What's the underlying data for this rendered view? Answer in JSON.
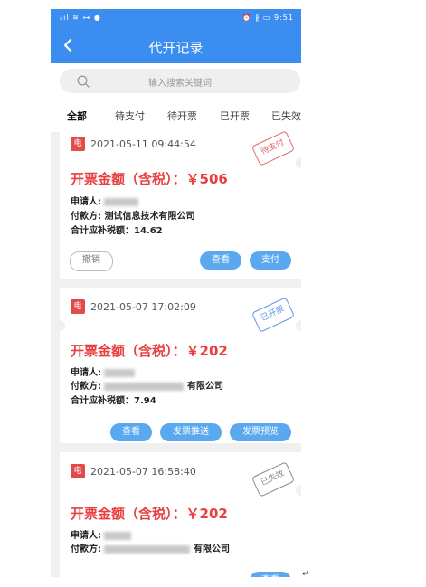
{
  "status_bar": {
    "left": "ₐıl ≋ ⊶ ●",
    "right": "⏰ ∦ ▭ 9:51"
  },
  "nav": {
    "title": "代开记录"
  },
  "search": {
    "placeholder": "输入搜索关键词"
  },
  "tabs": [
    "全部",
    "待支付",
    "待开票",
    "已开票",
    "已失效"
  ],
  "active_tab": "全部",
  "colors": {
    "primary": "#3b8ef0",
    "amount_red": "#e84040",
    "button_blue": "#5aa8f0"
  },
  "records": [
    {
      "badge": "电",
      "datetime": "2021-05-11 09:44:54",
      "status_stamp": "待支付",
      "amount_text": "开票金额（含税）：￥506",
      "applicant_label": "申请人:",
      "payer_label": "付款方:",
      "payer_name": "测试信息技术有限公司",
      "tax_line": "合计应补税额：14.62",
      "buttons": {
        "cancel": "撤销",
        "view": "查看",
        "pay": "支付"
      }
    },
    {
      "badge": "电",
      "datetime": "2021-05-07 17:02:09",
      "status_stamp": "已开票",
      "amount_text": "开票金额（含税）：￥202",
      "applicant_label": "申请人:",
      "payer_label": "付款方:",
      "payer_name_suffix": "有限公司",
      "tax_line": "合计应补税额：7.94",
      "buttons": {
        "view": "查看",
        "push": "发票推送",
        "preview": "发票预览"
      }
    },
    {
      "badge": "电",
      "datetime": "2021-05-07 16:58:40",
      "status_stamp": "已失效",
      "amount_text": "开票金额（含税）：￥202",
      "applicant_label": "申请人:",
      "payer_label": "付款方:",
      "payer_name_suffix": "有限公司",
      "buttons": {
        "view": "查看"
      }
    }
  ],
  "trailing_mark": "↵"
}
